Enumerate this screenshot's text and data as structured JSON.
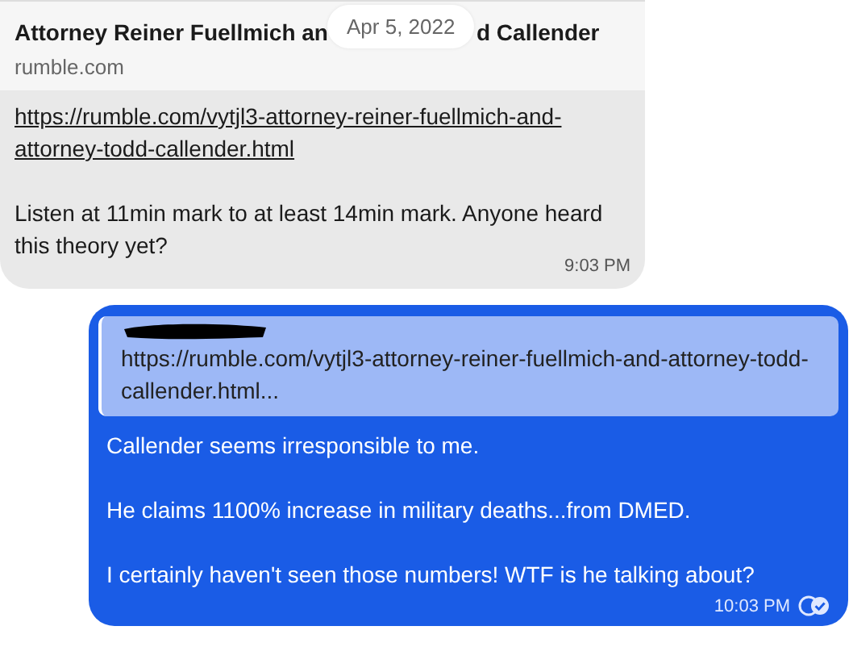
{
  "date_pill": "Apr 5, 2022",
  "incoming": {
    "preview": {
      "title_parts": [
        "Attorney Reiner Fuellmich an",
        "d Callender"
      ],
      "domain": "rumble.com"
    },
    "link": "https://rumble.com/vytjl3-attorney-reiner-fuellmich-and-attorney-todd-callender.html",
    "paragraphs": [
      "Listen at 11min mark to at least 14min mark.  Anyone heard this theory yet?"
    ],
    "time": "9:03 PM"
  },
  "outgoing": {
    "quote": {
      "text": "https://rumble.com/vytjl3-attorney-reiner-fuellmich-and-attorney-todd-callender.html..."
    },
    "paragraphs": [
      "Callender seems irresponsible to me.",
      "He claims 1100% increase in military deaths...from DMED.",
      "I certainly haven't seen those numbers! WTF is he talking about?"
    ],
    "time": "10:03 PM"
  }
}
